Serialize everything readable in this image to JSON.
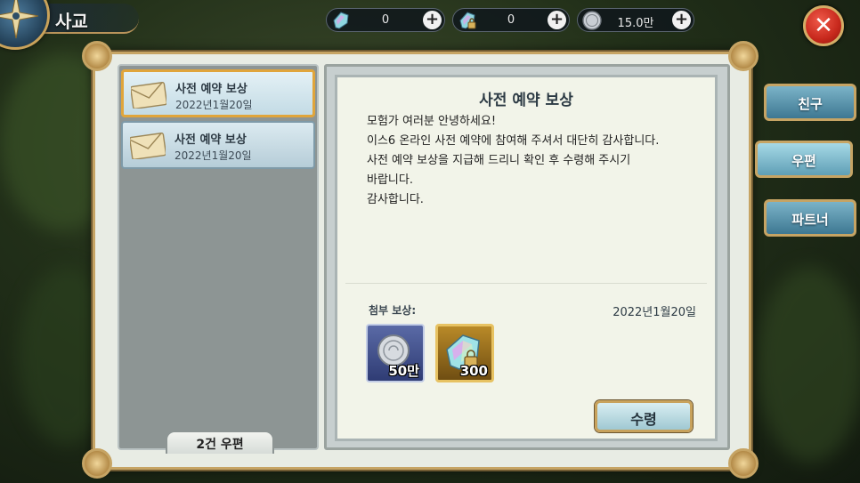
{
  "header": {
    "title": "사교"
  },
  "currencies": [
    {
      "icon": "crystal-icon",
      "value": "0"
    },
    {
      "icon": "locked-crystal-icon",
      "value": "0"
    },
    {
      "icon": "silver-coin-icon",
      "value": "15.0만"
    }
  ],
  "close": {
    "label": "✕"
  },
  "mail_list": {
    "items": [
      {
        "title": "사전 예약 보상",
        "date": "2022년1월20일",
        "selected": true
      },
      {
        "title": "사전 예약 보상",
        "date": "2022년1월20일",
        "selected": false
      }
    ],
    "count_label": "2건 우편"
  },
  "detail": {
    "title": "사전 예약 보상",
    "body": [
      "모험가 여러분 안녕하세요!",
      "이스6 온라인 사전 예약에 참여해 주셔서 대단히 감사합니다.",
      "사전 예약 보상을 지급해 드리니 확인 후 수령해 주시기",
      "바랍니다.",
      "감사합니다."
    ],
    "attach_label": "첨부 보상:",
    "date": "2022년1월20일",
    "rewards": [
      {
        "icon": "silver-coin-icon",
        "qty": "50만"
      },
      {
        "icon": "locked-crystal-icon",
        "qty": "300"
      }
    ],
    "claim_label": "수령"
  },
  "side_tabs": [
    {
      "label": "친구",
      "active": false
    },
    {
      "label": "우편",
      "active": true
    },
    {
      "label": "파트너",
      "active": false
    }
  ],
  "colors": {
    "accent_gold": "#c6a464",
    "selected_border": "#e0a53b",
    "close_red": "#c7281c"
  }
}
